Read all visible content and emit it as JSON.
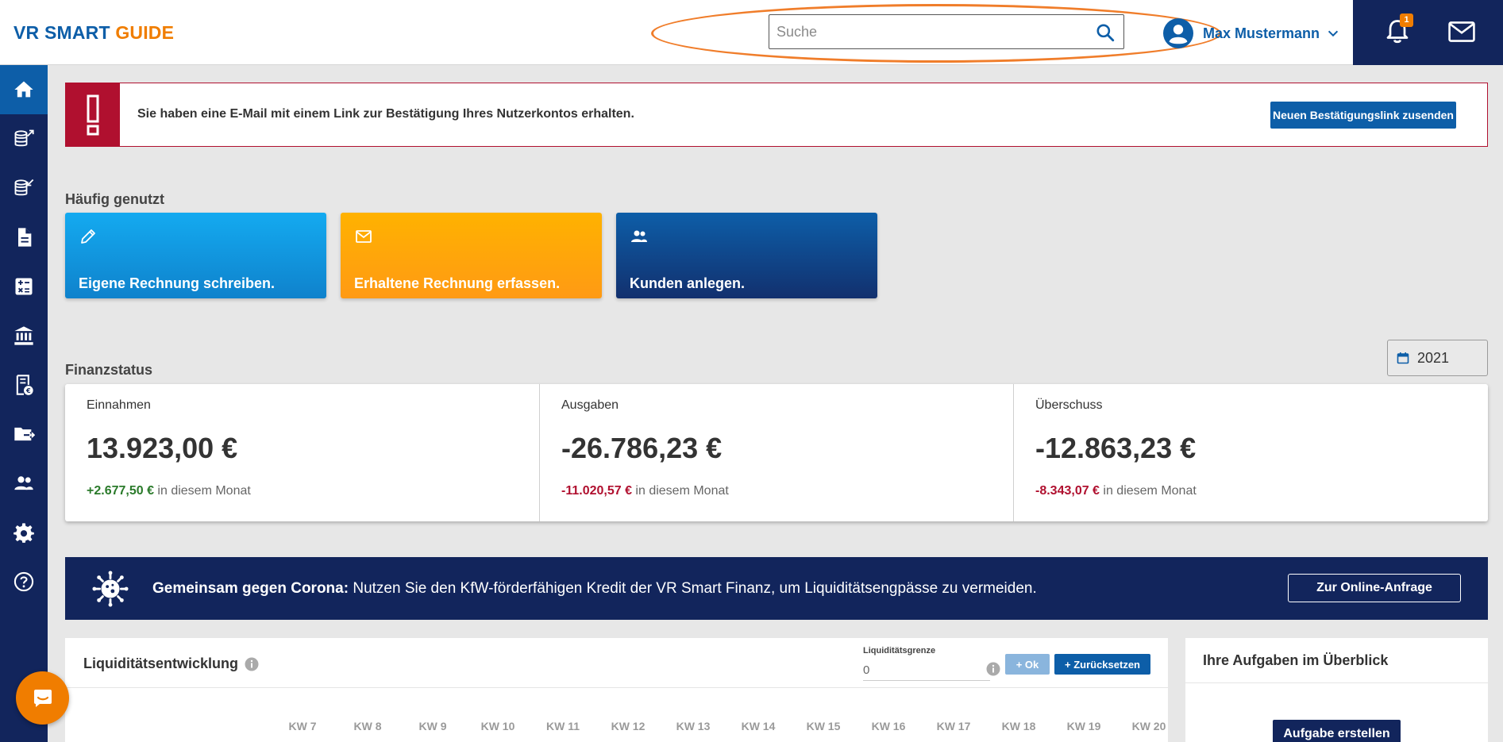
{
  "header": {
    "logo_part1": "VR SMART",
    "logo_part2": "GUIDE",
    "search_placeholder": "Suche",
    "user_name": "Max Mustermann",
    "notification_count": "1",
    "colors": {
      "brand_blue": "#0d5ea8",
      "brand_orange": "#f07d00",
      "navy": "#12255c"
    }
  },
  "sidebar": {
    "items": [
      {
        "name": "home",
        "icon": "home-icon",
        "active": true
      },
      {
        "name": "income",
        "icon": "coins-out-icon",
        "active": false
      },
      {
        "name": "expenses",
        "icon": "coins-in-icon",
        "active": false
      },
      {
        "name": "documents",
        "icon": "document-icon",
        "active": false
      },
      {
        "name": "calculator",
        "icon": "calculator-icon",
        "active": false
      },
      {
        "name": "bank",
        "icon": "bank-icon",
        "active": false
      },
      {
        "name": "receipts",
        "icon": "receipt-euro-icon",
        "active": false
      },
      {
        "name": "export",
        "icon": "folder-export-icon",
        "active": false
      },
      {
        "name": "contacts",
        "icon": "people-icon",
        "active": false
      },
      {
        "name": "settings",
        "icon": "gear-icon",
        "active": false
      },
      {
        "name": "help",
        "icon": "help-icon",
        "active": false
      }
    ]
  },
  "alert": {
    "message": "Sie haben eine E-Mail mit einem Link zur Bestätigung Ihres Nutzerkontos erhalten.",
    "button": "Neuen Bestätigungslink zusenden"
  },
  "frequent": {
    "title": "Häufig genutzt",
    "tiles": [
      {
        "label": "Eigene Rechnung schreiben.",
        "icon": "pencil-icon"
      },
      {
        "label": "Erhaltene Rechnung erfassen.",
        "icon": "envelope-icon"
      },
      {
        "label": "Kunden anlegen.",
        "icon": "people-icon"
      }
    ]
  },
  "finance": {
    "title": "Finanzstatus",
    "year": "2021",
    "columns": [
      {
        "label": "Einnahmen",
        "value": "13.923,00 €",
        "delta": "+2.677,50 €",
        "delta_suffix": "in diesem Monat",
        "delta_sign": "pos"
      },
      {
        "label": "Ausgaben",
        "value": "-26.786,23 €",
        "delta": "-11.020,57 €",
        "delta_suffix": "in diesem Monat",
        "delta_sign": "neg"
      },
      {
        "label": "Überschuss",
        "value": "-12.863,23 €",
        "delta": "-8.343,07 €",
        "delta_suffix": "in diesem Monat",
        "delta_sign": "neg"
      }
    ]
  },
  "banner": {
    "bold": "Gemeinsam gegen Corona:",
    "text": " Nutzen Sie den KfW-förderfähigen Kredit der VR Smart Finanz, um Liquiditätsengpässe zu vermeiden.",
    "button": "Zur Online-Anfrage"
  },
  "liquidity": {
    "title": "Liquiditätsentwicklung",
    "limit_label": "Liquiditätsgrenze",
    "limit_value": "0",
    "ok_button": "+ Ok",
    "reset_button": "+ Zurücksetzen",
    "weeks": [
      "KW 7",
      "KW 8",
      "KW 9",
      "KW 10",
      "KW 11",
      "KW 12",
      "KW 13",
      "KW 14",
      "KW 15",
      "KW 16",
      "KW 17",
      "KW 18",
      "KW 19",
      "KW 20"
    ]
  },
  "tasks": {
    "title": "Ihre Aufgaben im Überblick",
    "button": "Aufgabe erstellen"
  }
}
